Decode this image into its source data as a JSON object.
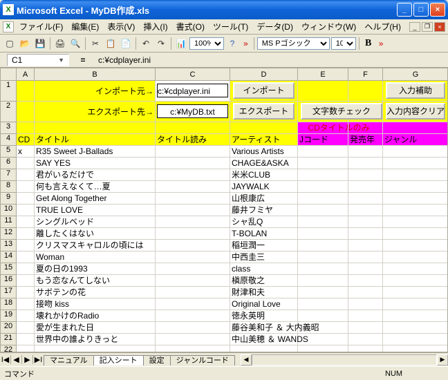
{
  "window": {
    "title": "Microsoft Excel - MyDB作成.xls"
  },
  "menu": [
    "ファイル(F)",
    "編集(E)",
    "表示(V)",
    "挿入(I)",
    "書式(O)",
    "ツール(T)",
    "データ(D)",
    "ウィンドウ(W)",
    "ヘルプ(H)"
  ],
  "toolbar": {
    "zoom": "100%",
    "font": "MS Pゴシック",
    "size": "10",
    "bold": "B"
  },
  "formula": {
    "name": "C1",
    "eq": "=",
    "value": "c:¥cdplayer.ini"
  },
  "cols": [
    "A",
    "B",
    "C",
    "D",
    "E",
    "F",
    "G"
  ],
  "row1": {
    "label": "インポート元→",
    "input": "c:¥cdplayer.ini",
    "btnImport": "インポート",
    "btnHelp": "入力補助"
  },
  "row2": {
    "label": "エクスポート先→",
    "input": "c:¥MyDB.txt",
    "btnExport": "エクスポート",
    "btnCheck": "文字数チェック",
    "btnClear": "入力内容クリア"
  },
  "row3note": "CDタイトルのみ",
  "hdr": {
    "a": "CD",
    "b": "タイトル",
    "c": "タイトル読み",
    "d": "アーティスト",
    "e": "Jコード",
    "f": "発売年",
    "g": "ジャンル"
  },
  "rows": [
    {
      "n": 5,
      "a": "x",
      "b": "R35 Sweet J-Ballads",
      "d": "Various Artists"
    },
    {
      "n": 6,
      "a": "",
      "b": "SAY YES",
      "d": "CHAGE&ASKA"
    },
    {
      "n": 7,
      "a": "",
      "b": "君がいるだけで",
      "d": "米米CLUB"
    },
    {
      "n": 8,
      "a": "",
      "b": "何も言えなくて…夏",
      "d": "JAYWALK"
    },
    {
      "n": 9,
      "a": "",
      "b": "Get Along Together",
      "d": "山根康広"
    },
    {
      "n": 10,
      "a": "",
      "b": "TRUE LOVE",
      "d": "藤井フミヤ"
    },
    {
      "n": 11,
      "a": "",
      "b": "シングルベッド",
      "d": "シャ乱Q"
    },
    {
      "n": 12,
      "a": "",
      "b": "離したくはない",
      "d": "T-BOLAN"
    },
    {
      "n": 13,
      "a": "",
      "b": "クリスマスキャロルの頃には",
      "d": "稲垣潤一"
    },
    {
      "n": 14,
      "a": "",
      "b": "Woman",
      "d": "中西圭三"
    },
    {
      "n": 15,
      "a": "",
      "b": "夏の日の1993",
      "d": "class"
    },
    {
      "n": 16,
      "a": "",
      "b": "もう恋なんてしない",
      "d": "槇原敬之"
    },
    {
      "n": 17,
      "a": "",
      "b": "サボテンの花",
      "d": "財津和夫"
    },
    {
      "n": 18,
      "a": "",
      "b": "接吻 kiss",
      "d": "Original Love"
    },
    {
      "n": 19,
      "a": "",
      "b": "壊れかけのRadio",
      "d": "徳永英明"
    },
    {
      "n": 20,
      "a": "",
      "b": "愛が生まれた日",
      "d": "藤谷美和子 ＆ 大内義昭"
    },
    {
      "n": 21,
      "a": "",
      "b": "世界中の誰よりきっと",
      "d": "中山美穂 ＆ WANDS"
    },
    {
      "n": 22,
      "a": "",
      "b": "",
      "d": ""
    }
  ],
  "tabs": [
    "マニュアル",
    "記入シート",
    "設定",
    "ジャンルコード"
  ],
  "activeTab": 1,
  "status": {
    "left": "コマンド",
    "num": "NUM"
  }
}
